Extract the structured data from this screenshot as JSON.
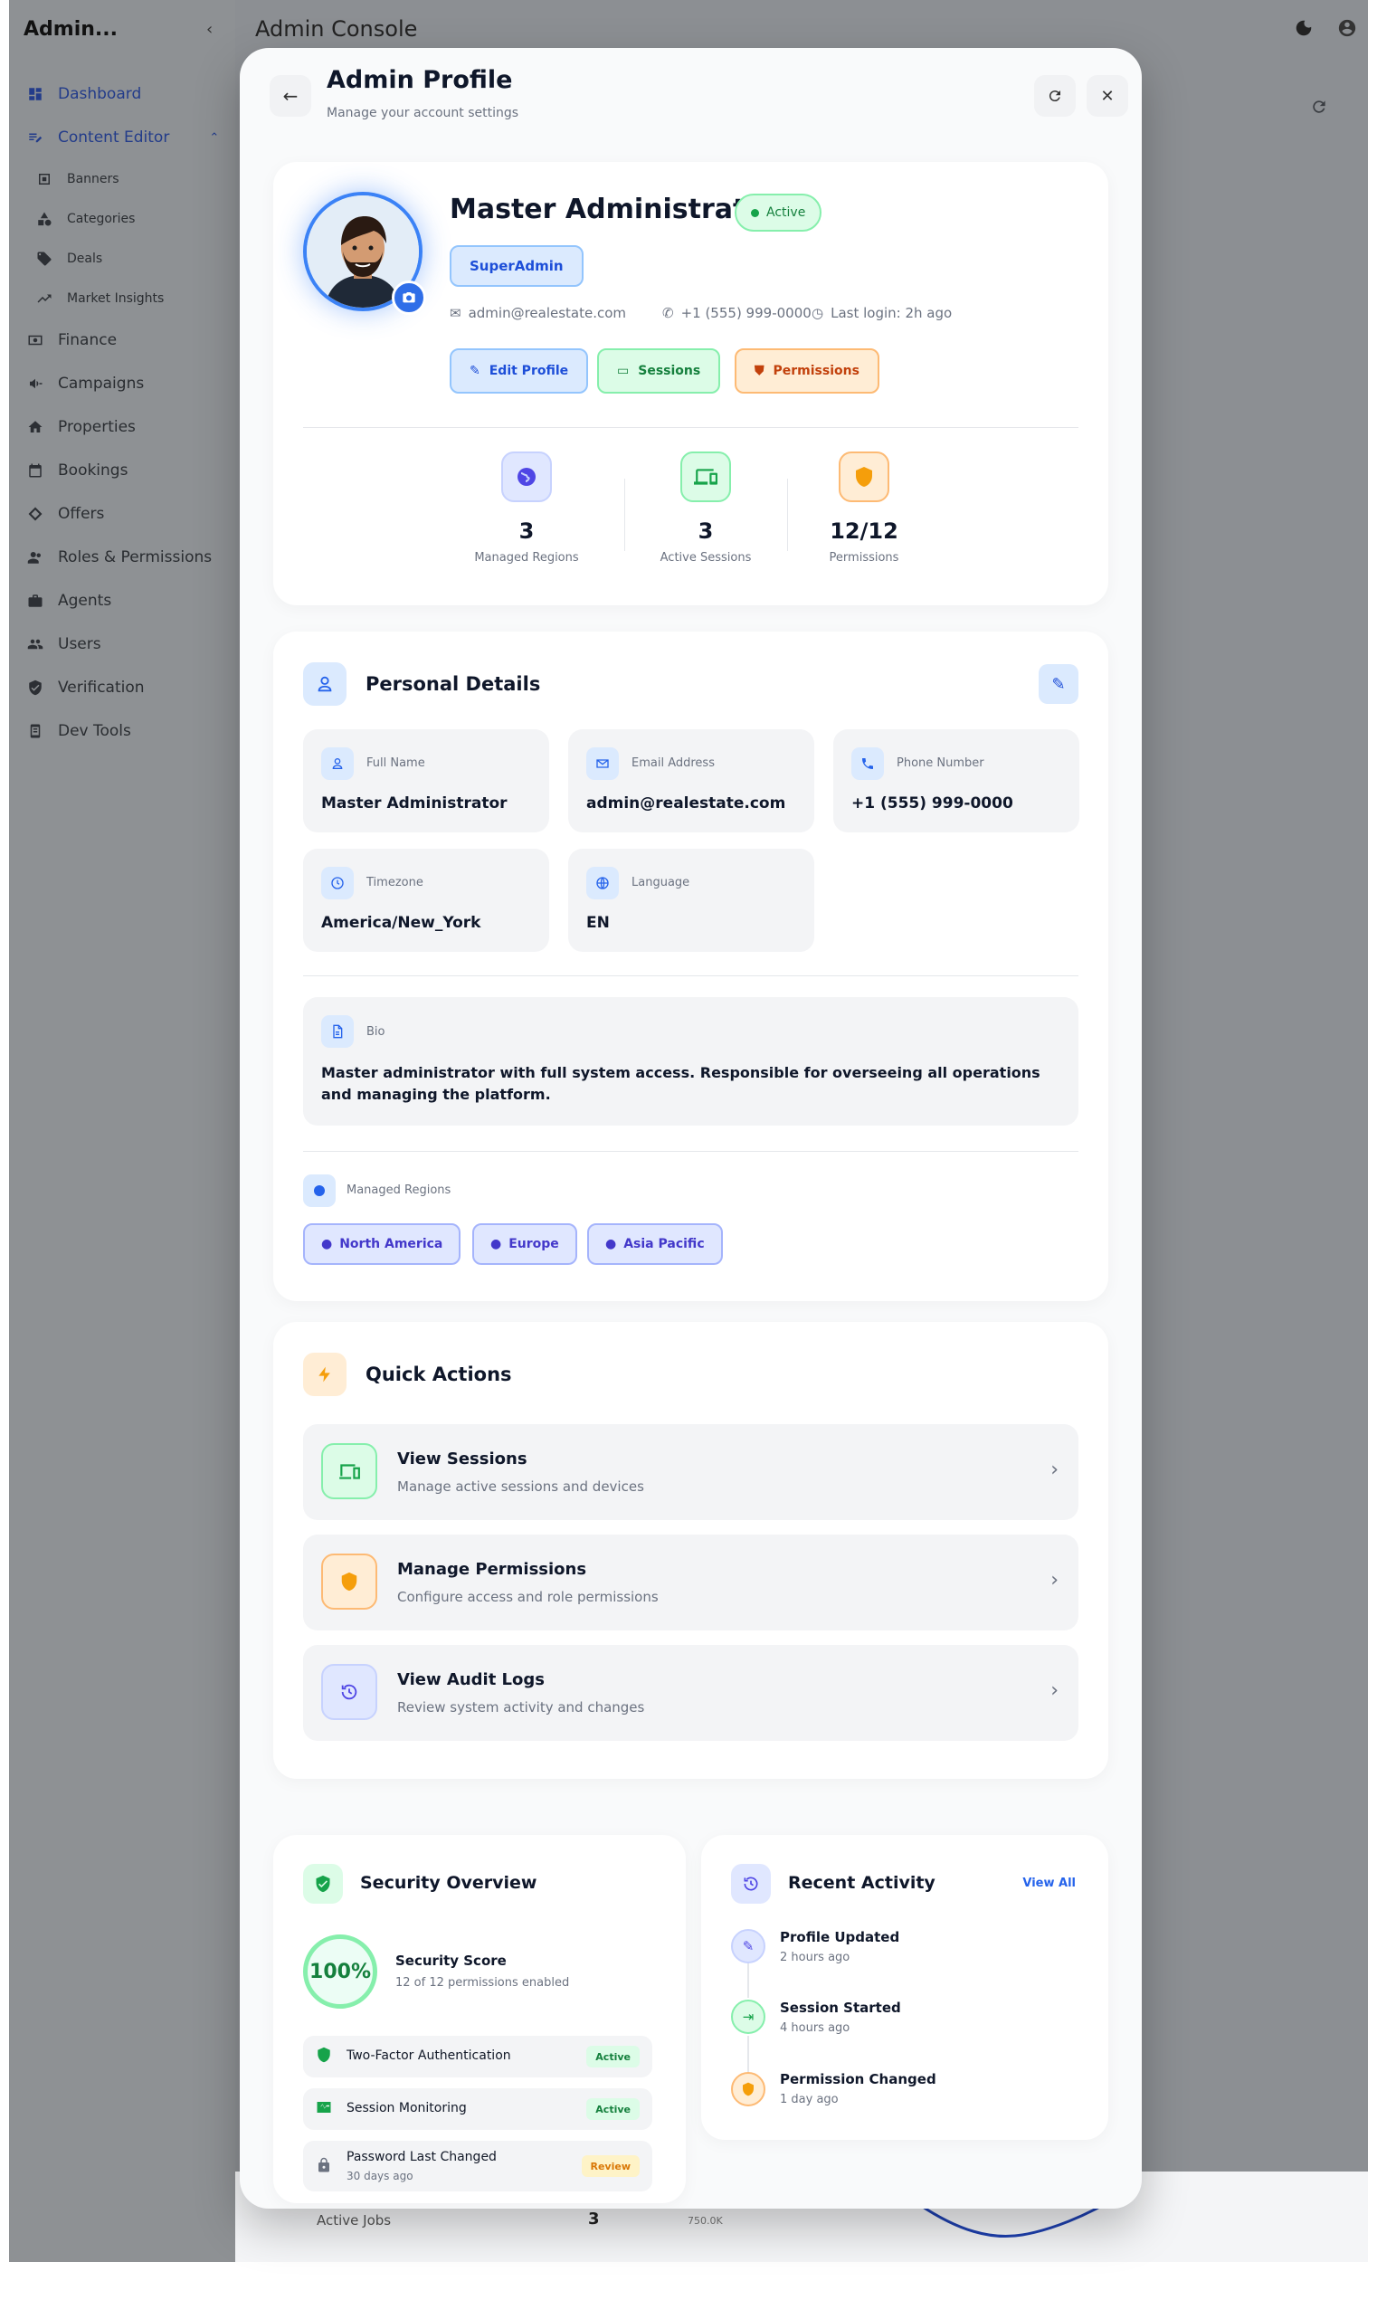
{
  "app": {
    "brand": "Admin...",
    "topbar_title": "Admin Console",
    "nav": [
      {
        "label": "Dashboard",
        "icon": "dashboard-icon"
      },
      {
        "label": "Content Editor",
        "icon": "edit-note-icon"
      },
      {
        "label": "Banners",
        "icon": "banner-icon"
      },
      {
        "label": "Categories",
        "icon": "category-icon"
      },
      {
        "label": "Deals",
        "icon": "tag-icon"
      },
      {
        "label": "Market Insights",
        "icon": "trend-icon"
      },
      {
        "label": "Finance",
        "icon": "finance-icon"
      },
      {
        "label": "Campaigns",
        "icon": "megaphone-icon"
      },
      {
        "label": "Properties",
        "icon": "home-icon"
      },
      {
        "label": "Bookings",
        "icon": "calendar-icon"
      },
      {
        "label": "Offers",
        "icon": "offer-icon"
      },
      {
        "label": "Roles & Permissions",
        "icon": "roles-icon"
      },
      {
        "label": "Agents",
        "icon": "briefcase-icon"
      },
      {
        "label": "Users",
        "icon": "users-icon"
      },
      {
        "label": "Verification",
        "icon": "verified-icon"
      },
      {
        "label": "Dev Tools",
        "icon": "devtools-icon"
      }
    ],
    "bg_row_label": "Active Jobs",
    "bg_row_value": "3",
    "bg_axis_label": "750.0K"
  },
  "modal": {
    "title": "Admin Profile",
    "subtitle": "Manage your account settings"
  },
  "profile": {
    "name": "Master Administrator",
    "status": "Active",
    "role": "SuperAdmin",
    "email": "admin@realestate.com",
    "phone": "+1 (555) 999-0000",
    "last_login": "Last login: 2h ago",
    "buttons": {
      "edit": "Edit Profile",
      "sessions": "Sessions",
      "permissions": "Permissions"
    },
    "stats": [
      {
        "value": "3",
        "label": "Managed Regions"
      },
      {
        "value": "3",
        "label": "Active Sessions"
      },
      {
        "value": "12/12",
        "label": "Permissions"
      }
    ]
  },
  "personal": {
    "title": "Personal Details",
    "fields": [
      {
        "label": "Full Name",
        "value": "Master Administrator"
      },
      {
        "label": "Email Address",
        "value": "admin@realestate.com"
      },
      {
        "label": "Phone Number",
        "value": "+1 (555) 999-0000"
      },
      {
        "label": "Timezone",
        "value": "America/New_York"
      },
      {
        "label": "Language",
        "value": "EN"
      }
    ],
    "bio_label": "Bio",
    "bio": "Master administrator with full system access. Responsible for overseeing all operations and managing the platform.",
    "regions_label": "Managed Regions",
    "regions": [
      "North America",
      "Europe",
      "Asia Pacific"
    ]
  },
  "quick_actions": {
    "title": "Quick Actions",
    "items": [
      {
        "title": "View Sessions",
        "subtitle": "Manage active sessions and devices"
      },
      {
        "title": "Manage Permissions",
        "subtitle": "Configure access and role permissions"
      },
      {
        "title": "View Audit Logs",
        "subtitle": "Review system activity and changes"
      }
    ]
  },
  "security": {
    "title": "Security Overview",
    "score": "100%",
    "score_label": "Security Score",
    "score_sub": "12 of 12 permissions enabled",
    "rows": [
      {
        "label": "Two-Factor Authentication",
        "badge": "Active"
      },
      {
        "label": "Session Monitoring",
        "badge": "Active"
      },
      {
        "label": "Password Last Changed",
        "sub": "30 days ago",
        "badge": "Review"
      }
    ]
  },
  "activity": {
    "title": "Recent Activity",
    "view_all": "View All",
    "items": [
      {
        "title": "Profile Updated",
        "time": "2 hours ago"
      },
      {
        "title": "Session Started",
        "time": "4 hours ago"
      },
      {
        "title": "Permission Changed",
        "time": "1 day ago"
      }
    ]
  },
  "colors": {
    "accent": "#2563eb",
    "success": "#16a34a",
    "warning": "#f59e0b",
    "indigo": "#4f46e5"
  }
}
